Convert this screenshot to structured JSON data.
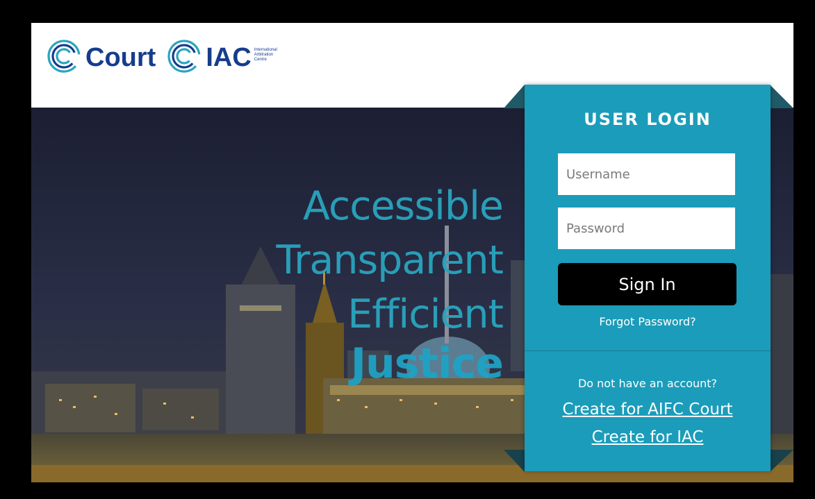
{
  "header": {
    "logo_court": "Court",
    "logo_iac": "IAC",
    "logo_iac_sub": [
      "International",
      "Arbitration",
      "Centre"
    ]
  },
  "hero": {
    "tagline": [
      "Accessible",
      "Transparent",
      "Efficient"
    ],
    "tagline_emphasis": "Justice"
  },
  "login": {
    "title": "USER LOGIN",
    "username_placeholder": "Username",
    "password_placeholder": "Password",
    "signin_label": "Sign In",
    "forgot_label": "Forgot Password?",
    "no_account_text": "Do not have an account?",
    "create_aifc_label": "Create for AIFC Court",
    "create_iac_label": "Create for IAC"
  },
  "colors": {
    "brand_navy": "#163d8c",
    "brand_teal": "#2aa5bf",
    "login_panel": "#1b9cba",
    "button": "#000000"
  },
  "icons": [
    "court-logo-icon",
    "iac-logo-icon"
  ]
}
